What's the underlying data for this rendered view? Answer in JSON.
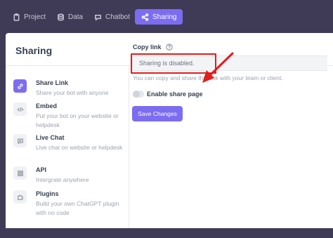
{
  "nav": {
    "tabs": [
      {
        "label": "Project",
        "icon": "clipboard-icon"
      },
      {
        "label": "Data",
        "icon": "database-icon"
      },
      {
        "label": "Chatbot",
        "icon": "chat-bubble-icon"
      },
      {
        "label": "Sharing",
        "icon": "share-icon",
        "active": true
      }
    ]
  },
  "panel": {
    "title": "Sharing"
  },
  "menu": {
    "items": [
      {
        "label": "Share Link",
        "description": "Share your bot with anyone",
        "icon": "link-icon",
        "active": true
      },
      {
        "label": "Embed",
        "description": "Put your bot on your website or helpdesk",
        "icon": "code-icon"
      },
      {
        "label": "Live Chat",
        "description": "Live chat on website or helpdesk",
        "icon": "message-icon"
      },
      {
        "label": "API",
        "description": "Intergrate anywhere",
        "icon": "grid-icon"
      },
      {
        "label": "Plugins",
        "description": "Build your own ChatGPT plugin with no code",
        "icon": "puzzle-icon"
      }
    ]
  },
  "share_link": {
    "copy_label": "Copy link",
    "input_value": "Sharing is disabled.",
    "helper_text": "You can copy and share this link with your team or client.",
    "toggle_label": "Enable share page",
    "toggle_on": false,
    "save_label": "Save Changes"
  },
  "colors": {
    "accent": "#7c6cf0",
    "nav_background": "#3f3b57",
    "annotation_red": "#e31c1c"
  }
}
